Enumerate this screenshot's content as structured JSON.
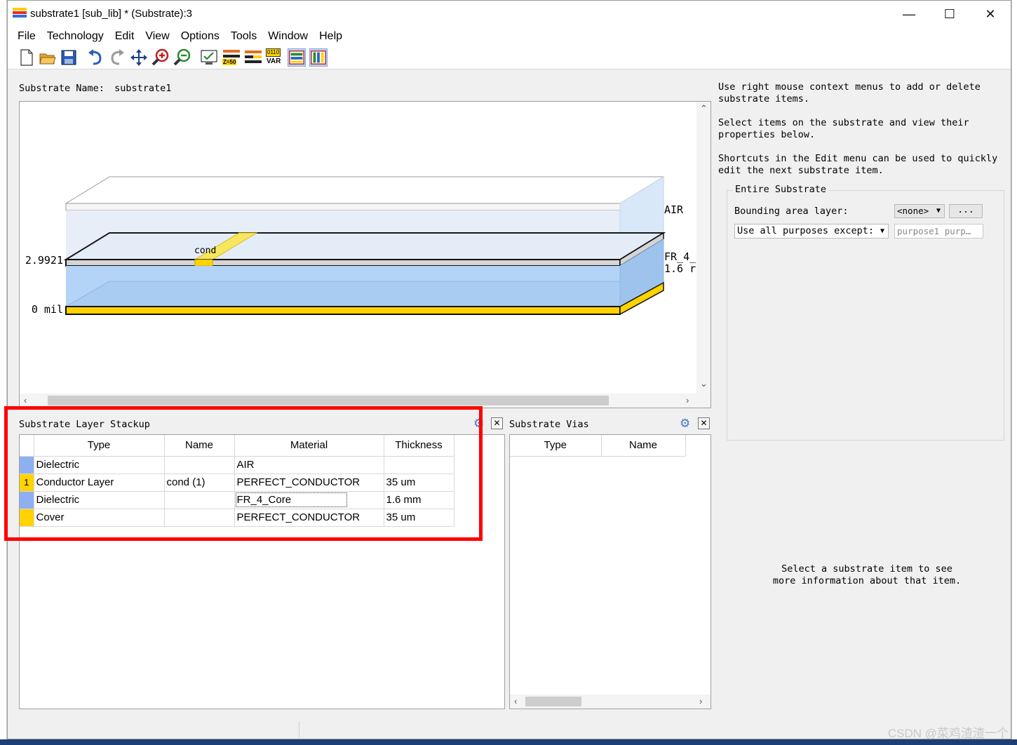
{
  "window": {
    "title": "substrate1 [sub_lib] * (Substrate):3",
    "controls": {
      "minimize": "—",
      "maximize": "☐",
      "close": "✕"
    }
  },
  "menu": [
    "File",
    "Technology",
    "Edit",
    "View",
    "Options",
    "Tools",
    "Window",
    "Help"
  ],
  "toolbar": {
    "icons": [
      "new-file-icon",
      "open-folder-icon",
      "save-icon",
      "undo-icon",
      "redo-icon",
      "pan-icon",
      "zoom-in-icon",
      "zoom-out-icon",
      "check-icon",
      "z50-icon",
      "layers-icon",
      "var-icon",
      "stack-horizontal-icon",
      "stack-vertical-icon"
    ],
    "z50_label": "Z=50",
    "var_label": "VAR",
    "var_bits": "0110"
  },
  "substrate": {
    "name_label": "Substrate Name:",
    "name": "substrate1"
  },
  "view3d": {
    "labels": {
      "air": "AIR",
      "fr4": "FR_4_",
      "fr4_thickness": "1.6 r",
      "cond": "cond",
      "height_top": "2.9921",
      "height_zero": "0 mil"
    }
  },
  "info": {
    "line1": "Use right mouse context menus to add or delete substrate items.",
    "line2": "Select items on the substrate and view their properties below.",
    "line3": "Shortcuts in the Edit menu can be used to quickly edit the next substrate item."
  },
  "entire_substrate": {
    "title": "Entire Substrate",
    "bounding_label": "Bounding area layer:",
    "bounding_value": "<none>",
    "bounding_button": "...",
    "purposes_select": "Use all purposes except:",
    "purposes_value": "purpose1 purp…"
  },
  "stackup": {
    "title": "Substrate Layer Stackup",
    "columns": [
      "Type",
      "Name",
      "Material",
      "Thickness"
    ],
    "rows": [
      {
        "swatch": "#8fb0f0",
        "index": "",
        "type": "Dielectric",
        "name": "",
        "material": "AIR",
        "thickness": ""
      },
      {
        "swatch": "#ffd200",
        "index": "1",
        "type": "Conductor Layer",
        "name": "cond (1)",
        "material": "PERFECT_CONDUCTOR",
        "thickness": "35 um"
      },
      {
        "swatch": "#8fb0f0",
        "index": "",
        "type": "Dielectric",
        "name": "",
        "material": "FR_4_Core",
        "thickness": "1.6 mm"
      },
      {
        "swatch": "#ffd200",
        "index": "",
        "type": "Cover",
        "name": "",
        "material": "PERFECT_CONDUCTOR",
        "thickness": "35 um"
      }
    ]
  },
  "vias": {
    "title": "Substrate Vias",
    "columns": [
      "Type",
      "Name"
    ]
  },
  "hint": {
    "line1": "Select a substrate item to see",
    "line2": "more information about that item."
  },
  "watermark": "CSDN @菜鸡渣渣一个"
}
